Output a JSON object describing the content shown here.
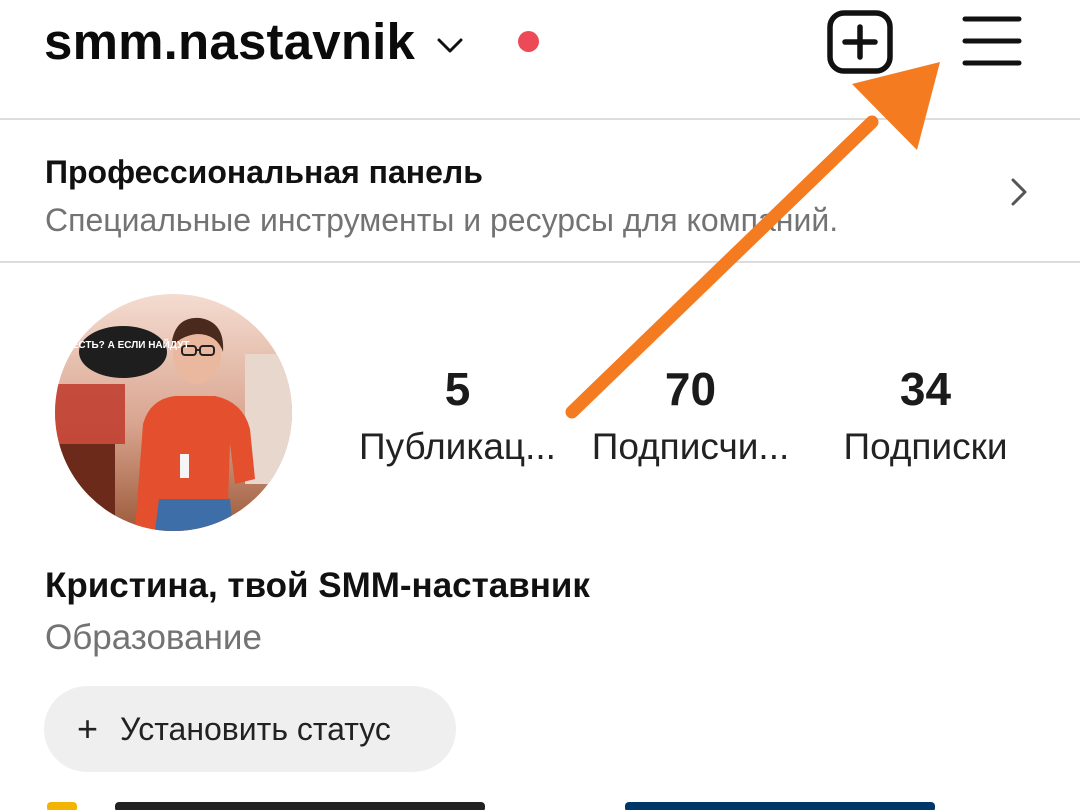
{
  "header": {
    "username": "smm.nastavnik",
    "chevron_icon": "chevron-down-icon",
    "notification_color": "#ed4956",
    "create_icon": "plus-square-icon",
    "menu_icon": "hamburger-menu-icon"
  },
  "pro_panel": {
    "title": "Профессиональная панель",
    "subtitle": "Специальные инструменты и ресурсы для компаний.",
    "chevron_icon": "chevron-right-icon"
  },
  "profile": {
    "avatar_icon": "profile-photo",
    "avatar_sign_text": "ТЗ ЕСТЬ? А ЕСЛИ НАЙДУТ",
    "stats": [
      {
        "value": "5",
        "label": "Публикац..."
      },
      {
        "value": "70",
        "label": "Подписчи..."
      },
      {
        "value": "34",
        "label": "Подписки"
      }
    ],
    "name": "Кристина, твой SMM-наставник",
    "category": "Образование",
    "status_button": {
      "plus": "+",
      "label": "Установить статус"
    }
  },
  "colors": {
    "accent_arrow": "#f47b20",
    "muted_text": "#737373",
    "status_bg": "#efefef",
    "link": "#00376b"
  }
}
